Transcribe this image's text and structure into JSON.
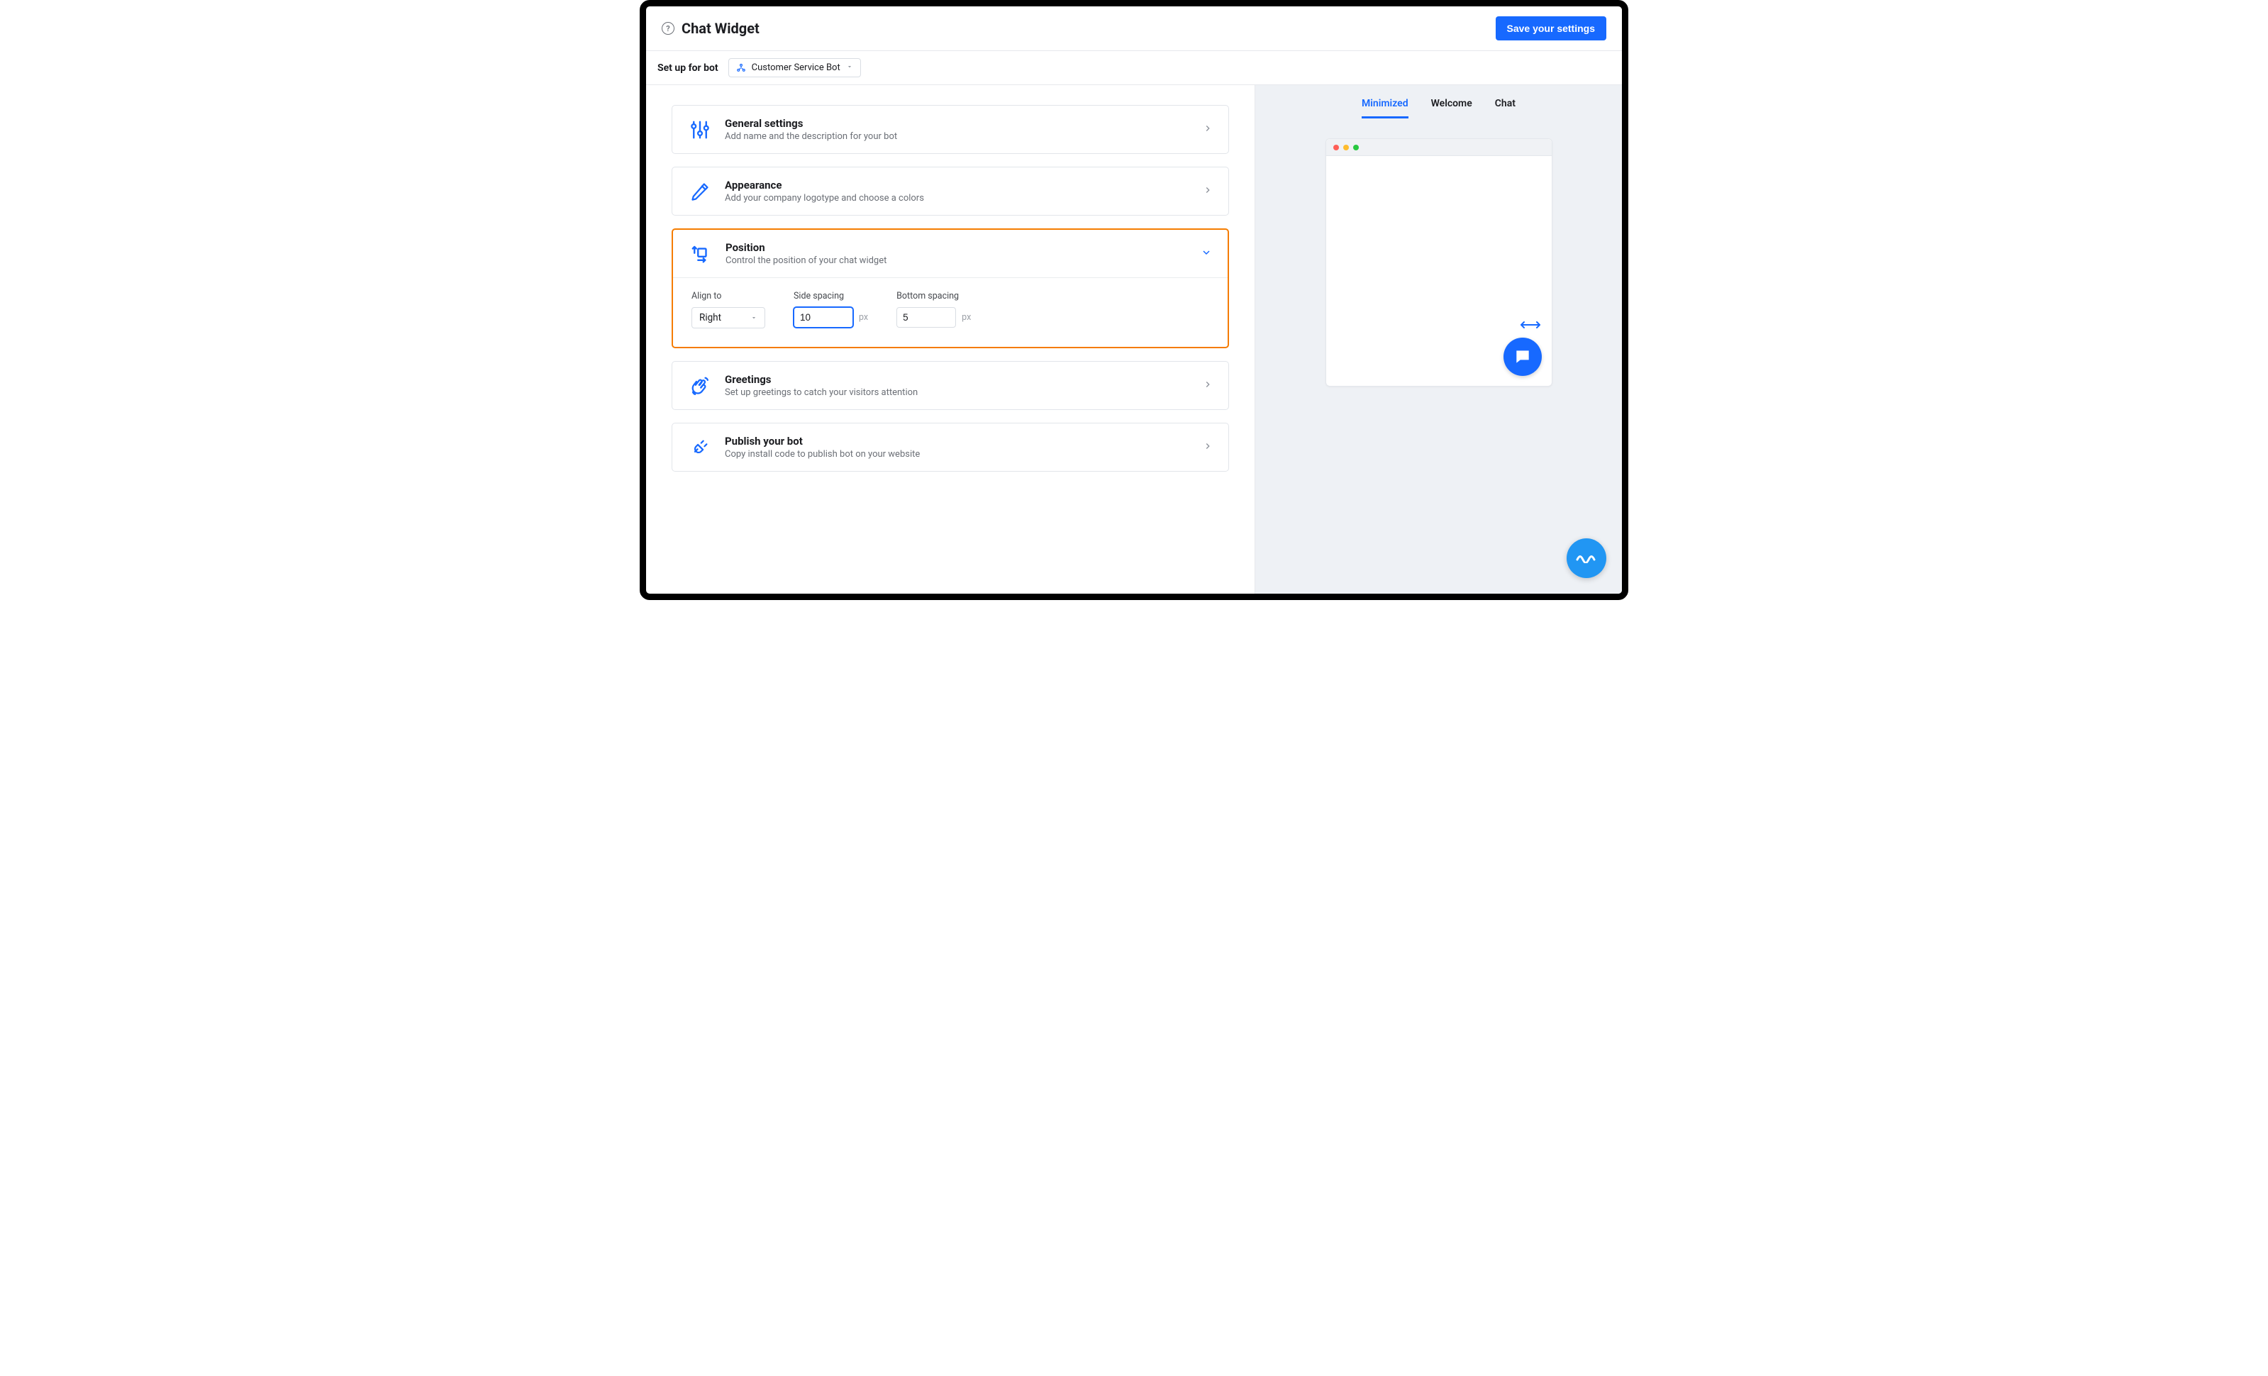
{
  "header": {
    "title": "Chat Widget",
    "save_label": "Save your settings"
  },
  "subheader": {
    "label": "Set up for bot",
    "selected_bot": "Customer Service Bot"
  },
  "sections": {
    "general": {
      "title": "General settings",
      "sub": "Add name and the description for your bot"
    },
    "appearance": {
      "title": "Appearance",
      "sub": "Add your company logotype and choose a colors"
    },
    "position": {
      "title": "Position",
      "sub": "Control the position of your chat widget"
    },
    "greetings": {
      "title": "Greetings",
      "sub": "Set up greetings to catch your visitors attention"
    },
    "publish": {
      "title": "Publish your bot",
      "sub": "Copy install code to publish bot on your website"
    }
  },
  "position_form": {
    "align_label": "Align to",
    "align_value": "Right",
    "side_label": "Side spacing",
    "side_value": "10",
    "bottom_label": "Bottom spacing",
    "bottom_value": "5",
    "unit": "px"
  },
  "preview": {
    "tabs": {
      "minimized": "Minimized",
      "welcome": "Welcome",
      "chat": "Chat"
    }
  }
}
